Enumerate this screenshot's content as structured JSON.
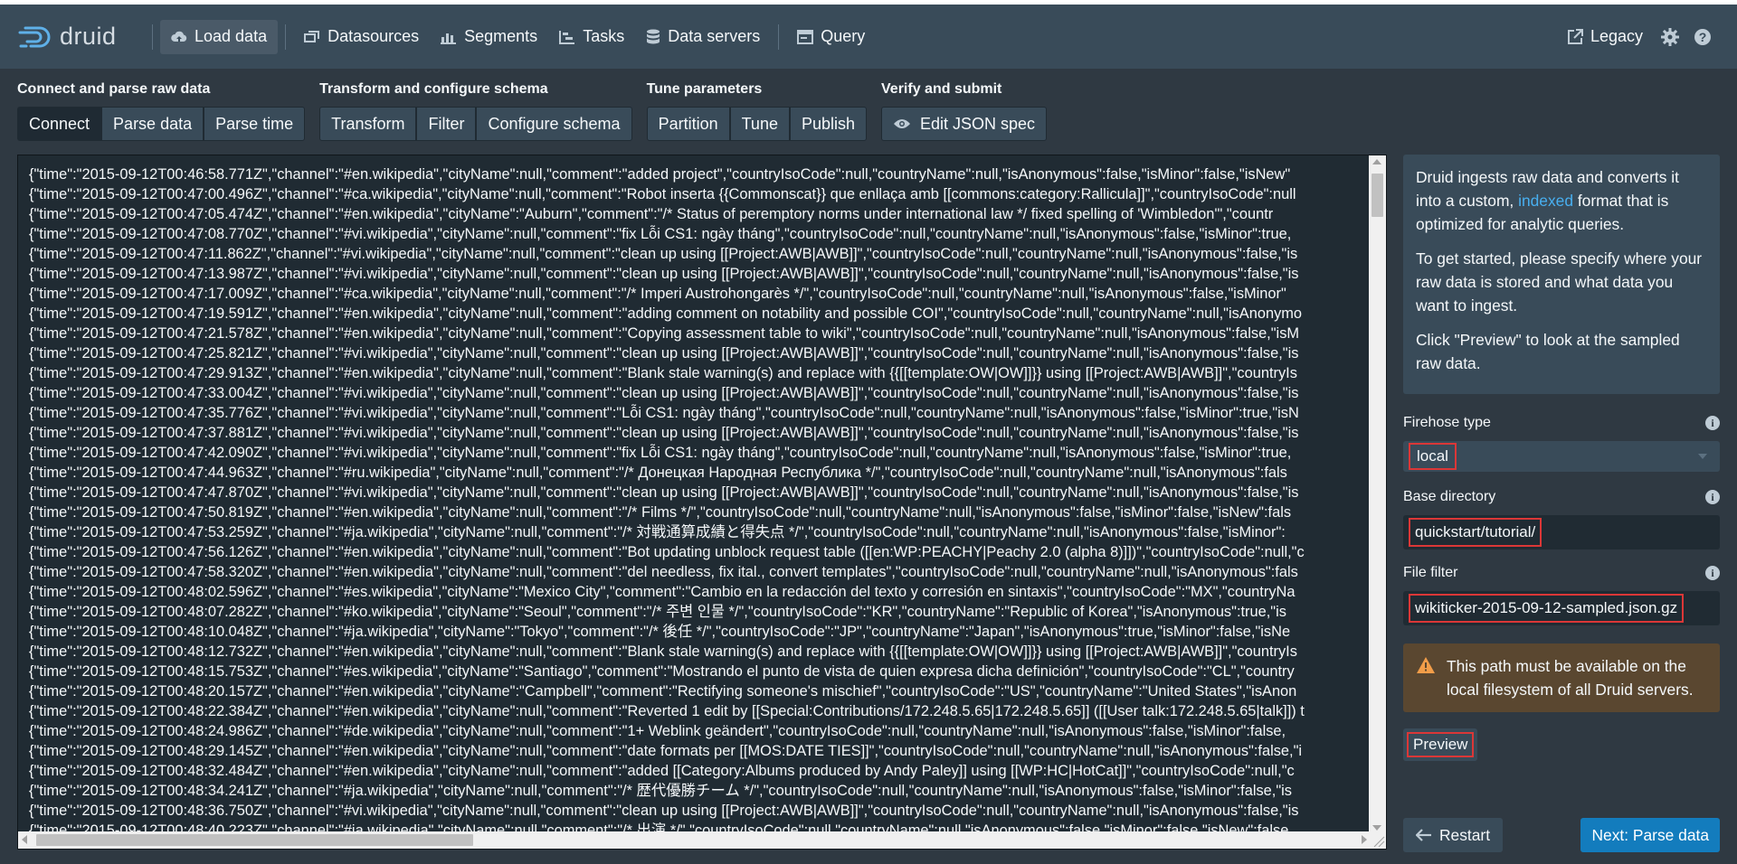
{
  "app": {
    "logo_text": "druid"
  },
  "nav": {
    "load_data": "Load data",
    "datasources": "Datasources",
    "segments": "Segments",
    "tasks": "Tasks",
    "data_servers": "Data servers",
    "query": "Query",
    "legacy": "Legacy"
  },
  "steps": [
    {
      "title": "Connect and parse raw data",
      "buttons": [
        "Connect",
        "Parse data",
        "Parse time"
      ]
    },
    {
      "title": "Transform and configure schema",
      "buttons": [
        "Transform",
        "Filter",
        "Configure schema"
      ]
    },
    {
      "title": "Tune parameters",
      "buttons": [
        "Partition",
        "Tune",
        "Publish"
      ]
    },
    {
      "title": "Verify and submit",
      "buttons": [
        "Edit JSON spec"
      ]
    }
  ],
  "raw_lines": [
    "{\"time\":\"2015-09-12T00:46:58.771Z\",\"channel\":\"#en.wikipedia\",\"cityName\":null,\"comment\":\"added project\",\"countryIsoCode\":null,\"countryName\":null,\"isAnonymous\":false,\"isMinor\":false,\"isNew\"",
    "{\"time\":\"2015-09-12T00:47:00.496Z\",\"channel\":\"#ca.wikipedia\",\"cityName\":null,\"comment\":\"Robot inserta {{Commonscat}} que enllaça amb [[commons:category:Rallicula]]\",\"countryIsoCode\":null",
    "{\"time\":\"2015-09-12T00:47:05.474Z\",\"channel\":\"#en.wikipedia\",\"cityName\":\"Auburn\",\"comment\":\"/* Status of peremptory norms under international law */ fixed spelling of 'Wimbledon'\",\"countr",
    "{\"time\":\"2015-09-12T00:47:08.770Z\",\"channel\":\"#vi.wikipedia\",\"cityName\":null,\"comment\":\"fix Lỗi CS1: ngày tháng\",\"countryIsoCode\":null,\"countryName\":null,\"isAnonymous\":false,\"isMinor\":true,",
    "{\"time\":\"2015-09-12T00:47:11.862Z\",\"channel\":\"#vi.wikipedia\",\"cityName\":null,\"comment\":\"clean up using [[Project:AWB|AWB]]\",\"countryIsoCode\":null,\"countryName\":null,\"isAnonymous\":false,\"is",
    "{\"time\":\"2015-09-12T00:47:13.987Z\",\"channel\":\"#vi.wikipedia\",\"cityName\":null,\"comment\":\"clean up using [[Project:AWB|AWB]]\",\"countryIsoCode\":null,\"countryName\":null,\"isAnonymous\":false,\"is",
    "{\"time\":\"2015-09-12T00:47:17.009Z\",\"channel\":\"#ca.wikipedia\",\"cityName\":null,\"comment\":\"/* Imperi Austrohongarès */\",\"countryIsoCode\":null,\"countryName\":null,\"isAnonymous\":false,\"isMinor\"",
    "{\"time\":\"2015-09-12T00:47:19.591Z\",\"channel\":\"#en.wikipedia\",\"cityName\":null,\"comment\":\"adding comment on notability and possible COI\",\"countryIsoCode\":null,\"countryName\":null,\"isAnonymo",
    "{\"time\":\"2015-09-12T00:47:21.578Z\",\"channel\":\"#en.wikipedia\",\"cityName\":null,\"comment\":\"Copying assessment table to wiki\",\"countryIsoCode\":null,\"countryName\":null,\"isAnonymous\":false,\"isM",
    "{\"time\":\"2015-09-12T00:47:25.821Z\",\"channel\":\"#vi.wikipedia\",\"cityName\":null,\"comment\":\"clean up using [[Project:AWB|AWB]]\",\"countryIsoCode\":null,\"countryName\":null,\"isAnonymous\":false,\"is",
    "{\"time\":\"2015-09-12T00:47:29.913Z\",\"channel\":\"#en.wikipedia\",\"cityName\":null,\"comment\":\"Blank stale warning(s) and replace with {{[[template:OW|OW]]}} using [[Project:AWB|AWB]]\",\"countryIs",
    "{\"time\":\"2015-09-12T00:47:33.004Z\",\"channel\":\"#vi.wikipedia\",\"cityName\":null,\"comment\":\"clean up using [[Project:AWB|AWB]]\",\"countryIsoCode\":null,\"countryName\":null,\"isAnonymous\":false,\"is",
    "{\"time\":\"2015-09-12T00:47:35.776Z\",\"channel\":\"#vi.wikipedia\",\"cityName\":null,\"comment\":\"Lỗi CS1: ngày tháng\",\"countryIsoCode\":null,\"countryName\":null,\"isAnonymous\":false,\"isMinor\":true,\"isN",
    "{\"time\":\"2015-09-12T00:47:37.881Z\",\"channel\":\"#vi.wikipedia\",\"cityName\":null,\"comment\":\"clean up using [[Project:AWB|AWB]]\",\"countryIsoCode\":null,\"countryName\":null,\"isAnonymous\":false,\"is",
    "{\"time\":\"2015-09-12T00:47:42.090Z\",\"channel\":\"#vi.wikipedia\",\"cityName\":null,\"comment\":\"fix Lỗi CS1: ngày tháng\",\"countryIsoCode\":null,\"countryName\":null,\"isAnonymous\":false,\"isMinor\":true,",
    "{\"time\":\"2015-09-12T00:47:44.963Z\",\"channel\":\"#ru.wikipedia\",\"cityName\":null,\"comment\":\"/* Донецкая Народная Республика */\",\"countryIsoCode\":null,\"countryName\":null,\"isAnonymous\":fals",
    "{\"time\":\"2015-09-12T00:47:47.870Z\",\"channel\":\"#vi.wikipedia\",\"cityName\":null,\"comment\":\"clean up using [[Project:AWB|AWB]]\",\"countryIsoCode\":null,\"countryName\":null,\"isAnonymous\":false,\"is",
    "{\"time\":\"2015-09-12T00:47:50.819Z\",\"channel\":\"#en.wikipedia\",\"cityName\":null,\"comment\":\"/* Films */\",\"countryIsoCode\":null,\"countryName\":null,\"isAnonymous\":false,\"isMinor\":false,\"isNew\":fals",
    "{\"time\":\"2015-09-12T00:47:53.259Z\",\"channel\":\"#ja.wikipedia\",\"cityName\":null,\"comment\":\"/* 対戦通算成績と得失点 */\",\"countryIsoCode\":null,\"countryName\":null,\"isAnonymous\":false,\"isMinor\":",
    "{\"time\":\"2015-09-12T00:47:56.126Z\",\"channel\":\"#en.wikipedia\",\"cityName\":null,\"comment\":\"Bot updating unblock request table ([[en:WP:PEACHY|Peachy 2.0 (alpha 8)]])\",\"countryIsoCode\":null,\"c",
    "{\"time\":\"2015-09-12T00:47:58.320Z\",\"channel\":\"#en.wikipedia\",\"cityName\":null,\"comment\":\"del needless, fix ital., convert templates\",\"countryIsoCode\":null,\"countryName\":null,\"isAnonymous\":fals",
    "{\"time\":\"2015-09-12T00:48:02.596Z\",\"channel\":\"#es.wikipedia\",\"cityName\":\"Mexico City\",\"comment\":\"Cambio en la redacción del texto y corresión en sintaxis\",\"countryIsoCode\":\"MX\",\"countryNa",
    "{\"time\":\"2015-09-12T00:48:07.282Z\",\"channel\":\"#ko.wikipedia\",\"cityName\":\"Seoul\",\"comment\":\"/* 주변 인물 */\",\"countryIsoCode\":\"KR\",\"countryName\":\"Republic of Korea\",\"isAnonymous\":true,\"is",
    "{\"time\":\"2015-09-12T00:48:10.048Z\",\"channel\":\"#ja.wikipedia\",\"cityName\":\"Tokyo\",\"comment\":\"/* 後任 */\",\"countryIsoCode\":\"JP\",\"countryName\":\"Japan\",\"isAnonymous\":true,\"isMinor\":false,\"isNe",
    "{\"time\":\"2015-09-12T00:48:12.732Z\",\"channel\":\"#en.wikipedia\",\"cityName\":null,\"comment\":\"Blank stale warning(s) and replace with {{[[template:OW|OW]]}} using [[Project:AWB|AWB]]\",\"countryIs",
    "{\"time\":\"2015-09-12T00:48:15.753Z\",\"channel\":\"#es.wikipedia\",\"cityName\":\"Santiago\",\"comment\":\"Mostrando el punto de vista de quien expresa dicha definición\",\"countryIsoCode\":\"CL\",\"country",
    "{\"time\":\"2015-09-12T00:48:20.157Z\",\"channel\":\"#en.wikipedia\",\"cityName\":\"Campbell\",\"comment\":\"Rectifying someone's mischief\",\"countryIsoCode\":\"US\",\"countryName\":\"United States\",\"isAnon",
    "{\"time\":\"2015-09-12T00:48:22.384Z\",\"channel\":\"#en.wikipedia\",\"cityName\":null,\"comment\":\"Reverted 1 edit by [[Special:Contributions/172.248.5.65|172.248.5.65]] ([[User talk:172.248.5.65|talk]]) t",
    "{\"time\":\"2015-09-12T00:48:24.986Z\",\"channel\":\"#de.wikipedia\",\"cityName\":null,\"comment\":\"1+ Weblink geändert\",\"countryIsoCode\":null,\"countryName\":null,\"isAnonymous\":false,\"isMinor\":false,",
    "{\"time\":\"2015-09-12T00:48:29.145Z\",\"channel\":\"#en.wikipedia\",\"cityName\":null,\"comment\":\"date formats per [[MOS:DATE TIES]]\",\"countryIsoCode\":null,\"countryName\":null,\"isAnonymous\":false,\"i",
    "{\"time\":\"2015-09-12T00:48:32.484Z\",\"channel\":\"#en.wikipedia\",\"cityName\":null,\"comment\":\"added [[Category:Albums produced by Andy Paley]] using [[WP:HC|HotCat]]\",\"countryIsoCode\":null,\"c",
    "{\"time\":\"2015-09-12T00:48:34.241Z\",\"channel\":\"#ja.wikipedia\",\"cityName\":null,\"comment\":\"/* 歴代優勝チーム */\",\"countryIsoCode\":null,\"countryName\":null,\"isAnonymous\":false,\"isMinor\":false,\"is",
    "{\"time\":\"2015-09-12T00:48:36.750Z\",\"channel\":\"#vi.wikipedia\",\"cityName\":null,\"comment\":\"clean up using [[Project:AWB|AWB]]\",\"countryIsoCode\":null,\"countryName\":null,\"isAnonymous\":false,\"is",
    "{\"time\":\"2015-09-12T00:48:40.223Z\",\"channel\":\"#ja.wikipedia\",\"cityName\":null,\"comment\":\"/* 出演 */\",\"countryIsoCode\":null,\"countryName\":null,\"isAnonymous\":false,\"isMinor\":false,\"isNew\":false,"
  ],
  "info": {
    "p1_before": "Druid ingests raw data and converts it into a custom, ",
    "p1_link": "indexed",
    "p1_after": " format that is optimized for analytic queries.",
    "p2": "To get started, please specify where your raw data is stored and what data you want to ingest.",
    "p3": "Click \"Preview\" to look at the sampled raw data."
  },
  "firehose": {
    "label": "Firehose type",
    "value": "local"
  },
  "base_dir": {
    "label": "Base directory",
    "value": "quickstart/tutorial/"
  },
  "file_filter": {
    "label": "File filter",
    "value": "wikiticker-2015-09-12-sampled.json.gz"
  },
  "warning": "This path must be available on the local filesystem of all Druid servers.",
  "buttons": {
    "preview": "Preview",
    "restart": "Restart",
    "next": "Next: Parse data"
  },
  "colors": {
    "accent": "#137cbd",
    "link": "#48aff0",
    "highlight_border": "#db3737",
    "warning_bg": "#5a4730"
  }
}
